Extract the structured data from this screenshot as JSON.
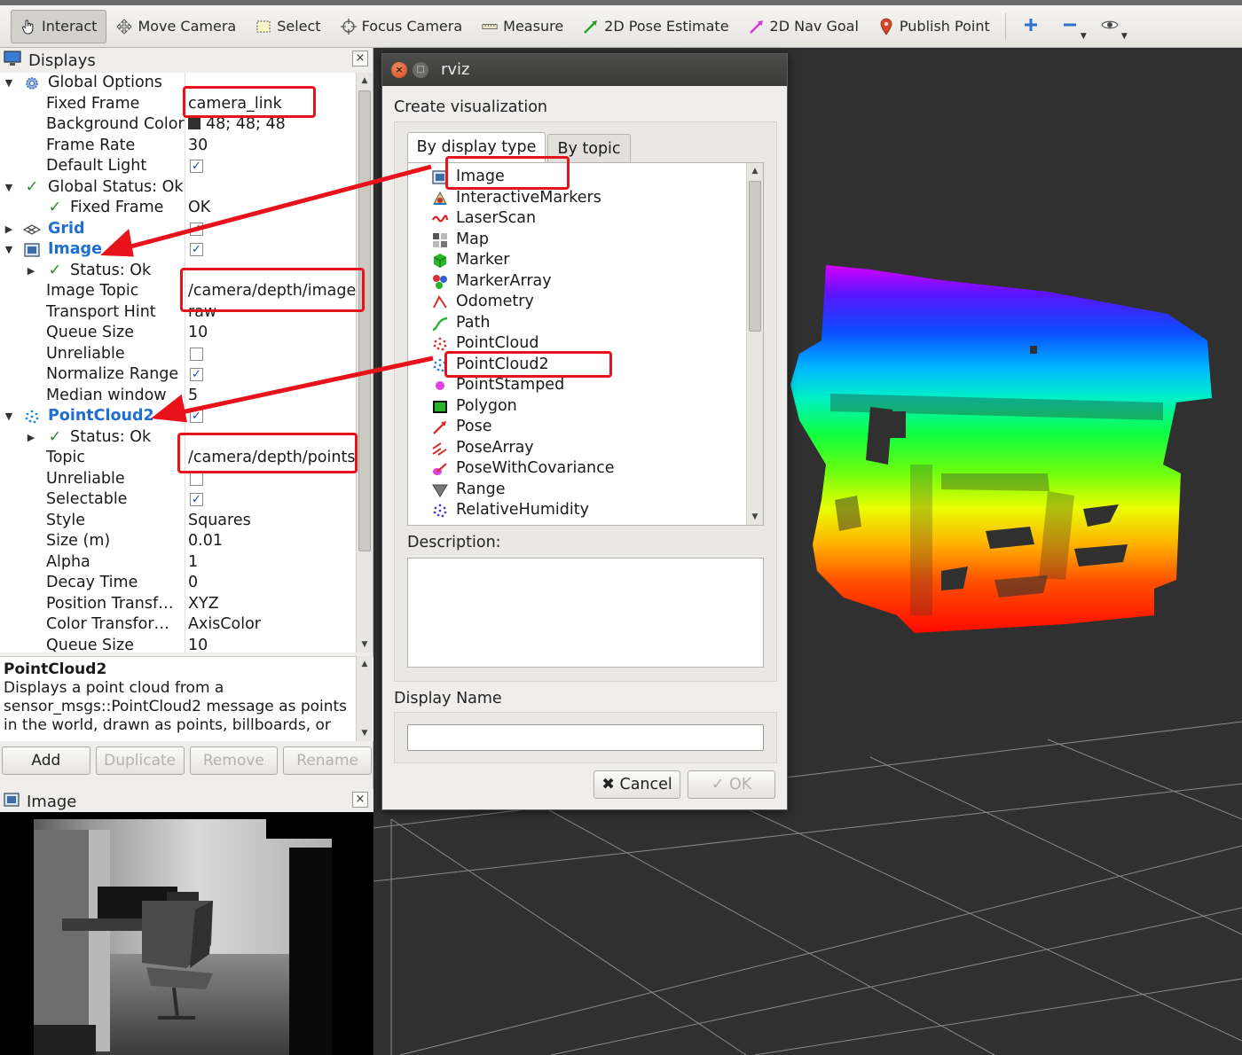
{
  "toolbar": {
    "tools": [
      "Interact",
      "Move Camera",
      "Select",
      "Focus Camera",
      "Measure",
      "2D Pose Estimate",
      "2D Nav Goal",
      "Publish Point"
    ],
    "active": "Interact"
  },
  "displays_panel": {
    "title": "Displays",
    "close": "×",
    "rows": [
      {
        "name": "Global Options",
        "value": ""
      },
      {
        "name": "Fixed Frame",
        "value": "camera_link"
      },
      {
        "name": "Background Color",
        "value": "48; 48; 48"
      },
      {
        "name": "Frame Rate",
        "value": "30"
      },
      {
        "name": "Default Light",
        "value": ""
      },
      {
        "name": "Global Status: Ok",
        "value": ""
      },
      {
        "name": "Fixed Frame",
        "value": "OK"
      },
      {
        "name": "Grid",
        "value": ""
      },
      {
        "name": "Image",
        "value": ""
      },
      {
        "name": "Status: Ok",
        "value": ""
      },
      {
        "name": "Image Topic",
        "value": "/camera/depth/image"
      },
      {
        "name": "Transport Hint",
        "value": "raw"
      },
      {
        "name": "Queue Size",
        "value": "10"
      },
      {
        "name": "Unreliable",
        "value": ""
      },
      {
        "name": "Normalize Range",
        "value": ""
      },
      {
        "name": "Median window",
        "value": "5"
      },
      {
        "name": "PointCloud2",
        "value": ""
      },
      {
        "name": "Status: Ok",
        "value": ""
      },
      {
        "name": "Topic",
        "value": "/camera/depth/points"
      },
      {
        "name": "Unreliable",
        "value": ""
      },
      {
        "name": "Selectable",
        "value": ""
      },
      {
        "name": "Style",
        "value": "Squares"
      },
      {
        "name": "Size (m)",
        "value": "0.01"
      },
      {
        "name": "Alpha",
        "value": "1"
      },
      {
        "name": "Decay Time",
        "value": "0"
      },
      {
        "name": "Position Transf…",
        "value": "XYZ"
      },
      {
        "name": "Color Transfor…",
        "value": "AxisColor"
      },
      {
        "name": "Queue Size",
        "value": "10"
      }
    ],
    "description_title": "PointCloud2",
    "description_text": "Displays a point cloud from a sensor_msgs::PointCloud2 message as points in the world, drawn as points, billboards, or",
    "buttons": {
      "add": "Add",
      "duplicate": "Duplicate",
      "remove": "Remove",
      "rename": "Rename"
    }
  },
  "image_panel": {
    "title": "Image",
    "close": "×"
  },
  "dialog": {
    "window_title": "rviz",
    "heading": "Create visualization",
    "tabs": [
      "By display type",
      "By topic"
    ],
    "active_tab": "By display type",
    "items": [
      "Image",
      "InteractiveMarkers",
      "LaserScan",
      "Map",
      "Marker",
      "MarkerArray",
      "Odometry",
      "Path",
      "PointCloud",
      "PointCloud2",
      "PointStamped",
      "Polygon",
      "Pose",
      "PoseArray",
      "PoseWithCovariance",
      "Range",
      "RelativeHumidity"
    ],
    "description_label": "Description:",
    "display_name_label": "Display Name",
    "display_name_value": "",
    "cancel": "Cancel",
    "ok": "OK"
  },
  "colors": {
    "annotation": "#e8121a",
    "background": "#303030",
    "link_blue": "#1f6fd1"
  }
}
